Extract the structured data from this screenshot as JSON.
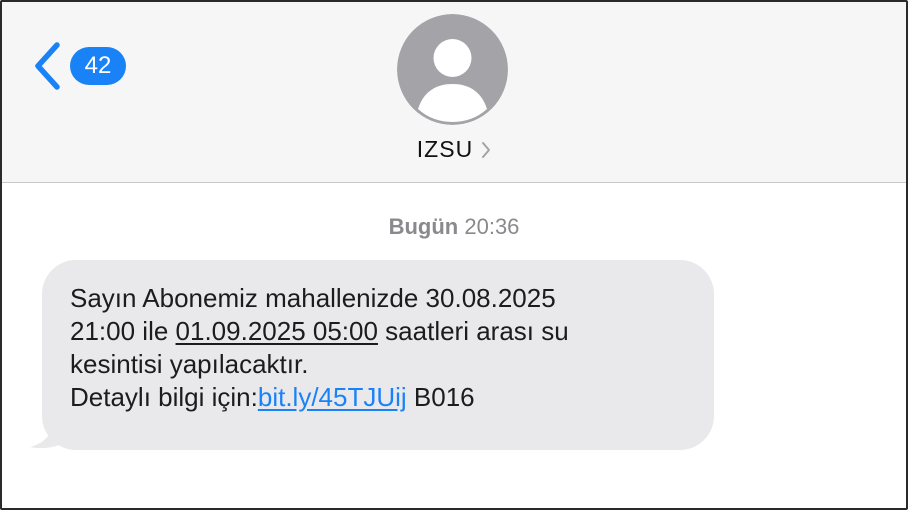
{
  "header": {
    "back_icon": "chevron-left-icon",
    "unread_count": "42",
    "contact": {
      "name": "IZSU",
      "avatar_icon": "person-silhouette-icon",
      "chevron_icon": "chevron-right-icon"
    }
  },
  "thread": {
    "timestamp": {
      "day": "Bugün",
      "time": "20:36"
    },
    "messages": [
      {
        "line1": "Sayın Abonemiz mahallenizde  30.08.2025",
        "line2_start": "21:00 ile ",
        "line2_underlined": "01.09.2025 05:00",
        "line2_end": " saatleri arası su",
        "line3": "kesintisi yapılacaktır.",
        "line4_start": "Detaylı bilgi için:",
        "link_text": "bit.ly/45TJUij",
        "line4_end": " B016"
      }
    ]
  },
  "colors": {
    "accent": "#1a82f7",
    "bubble_incoming": "#e9e9eb",
    "header_bg": "#f6f6f6",
    "secondary_text": "#8a8a8e",
    "avatar_bg": "#a3a3a8"
  }
}
